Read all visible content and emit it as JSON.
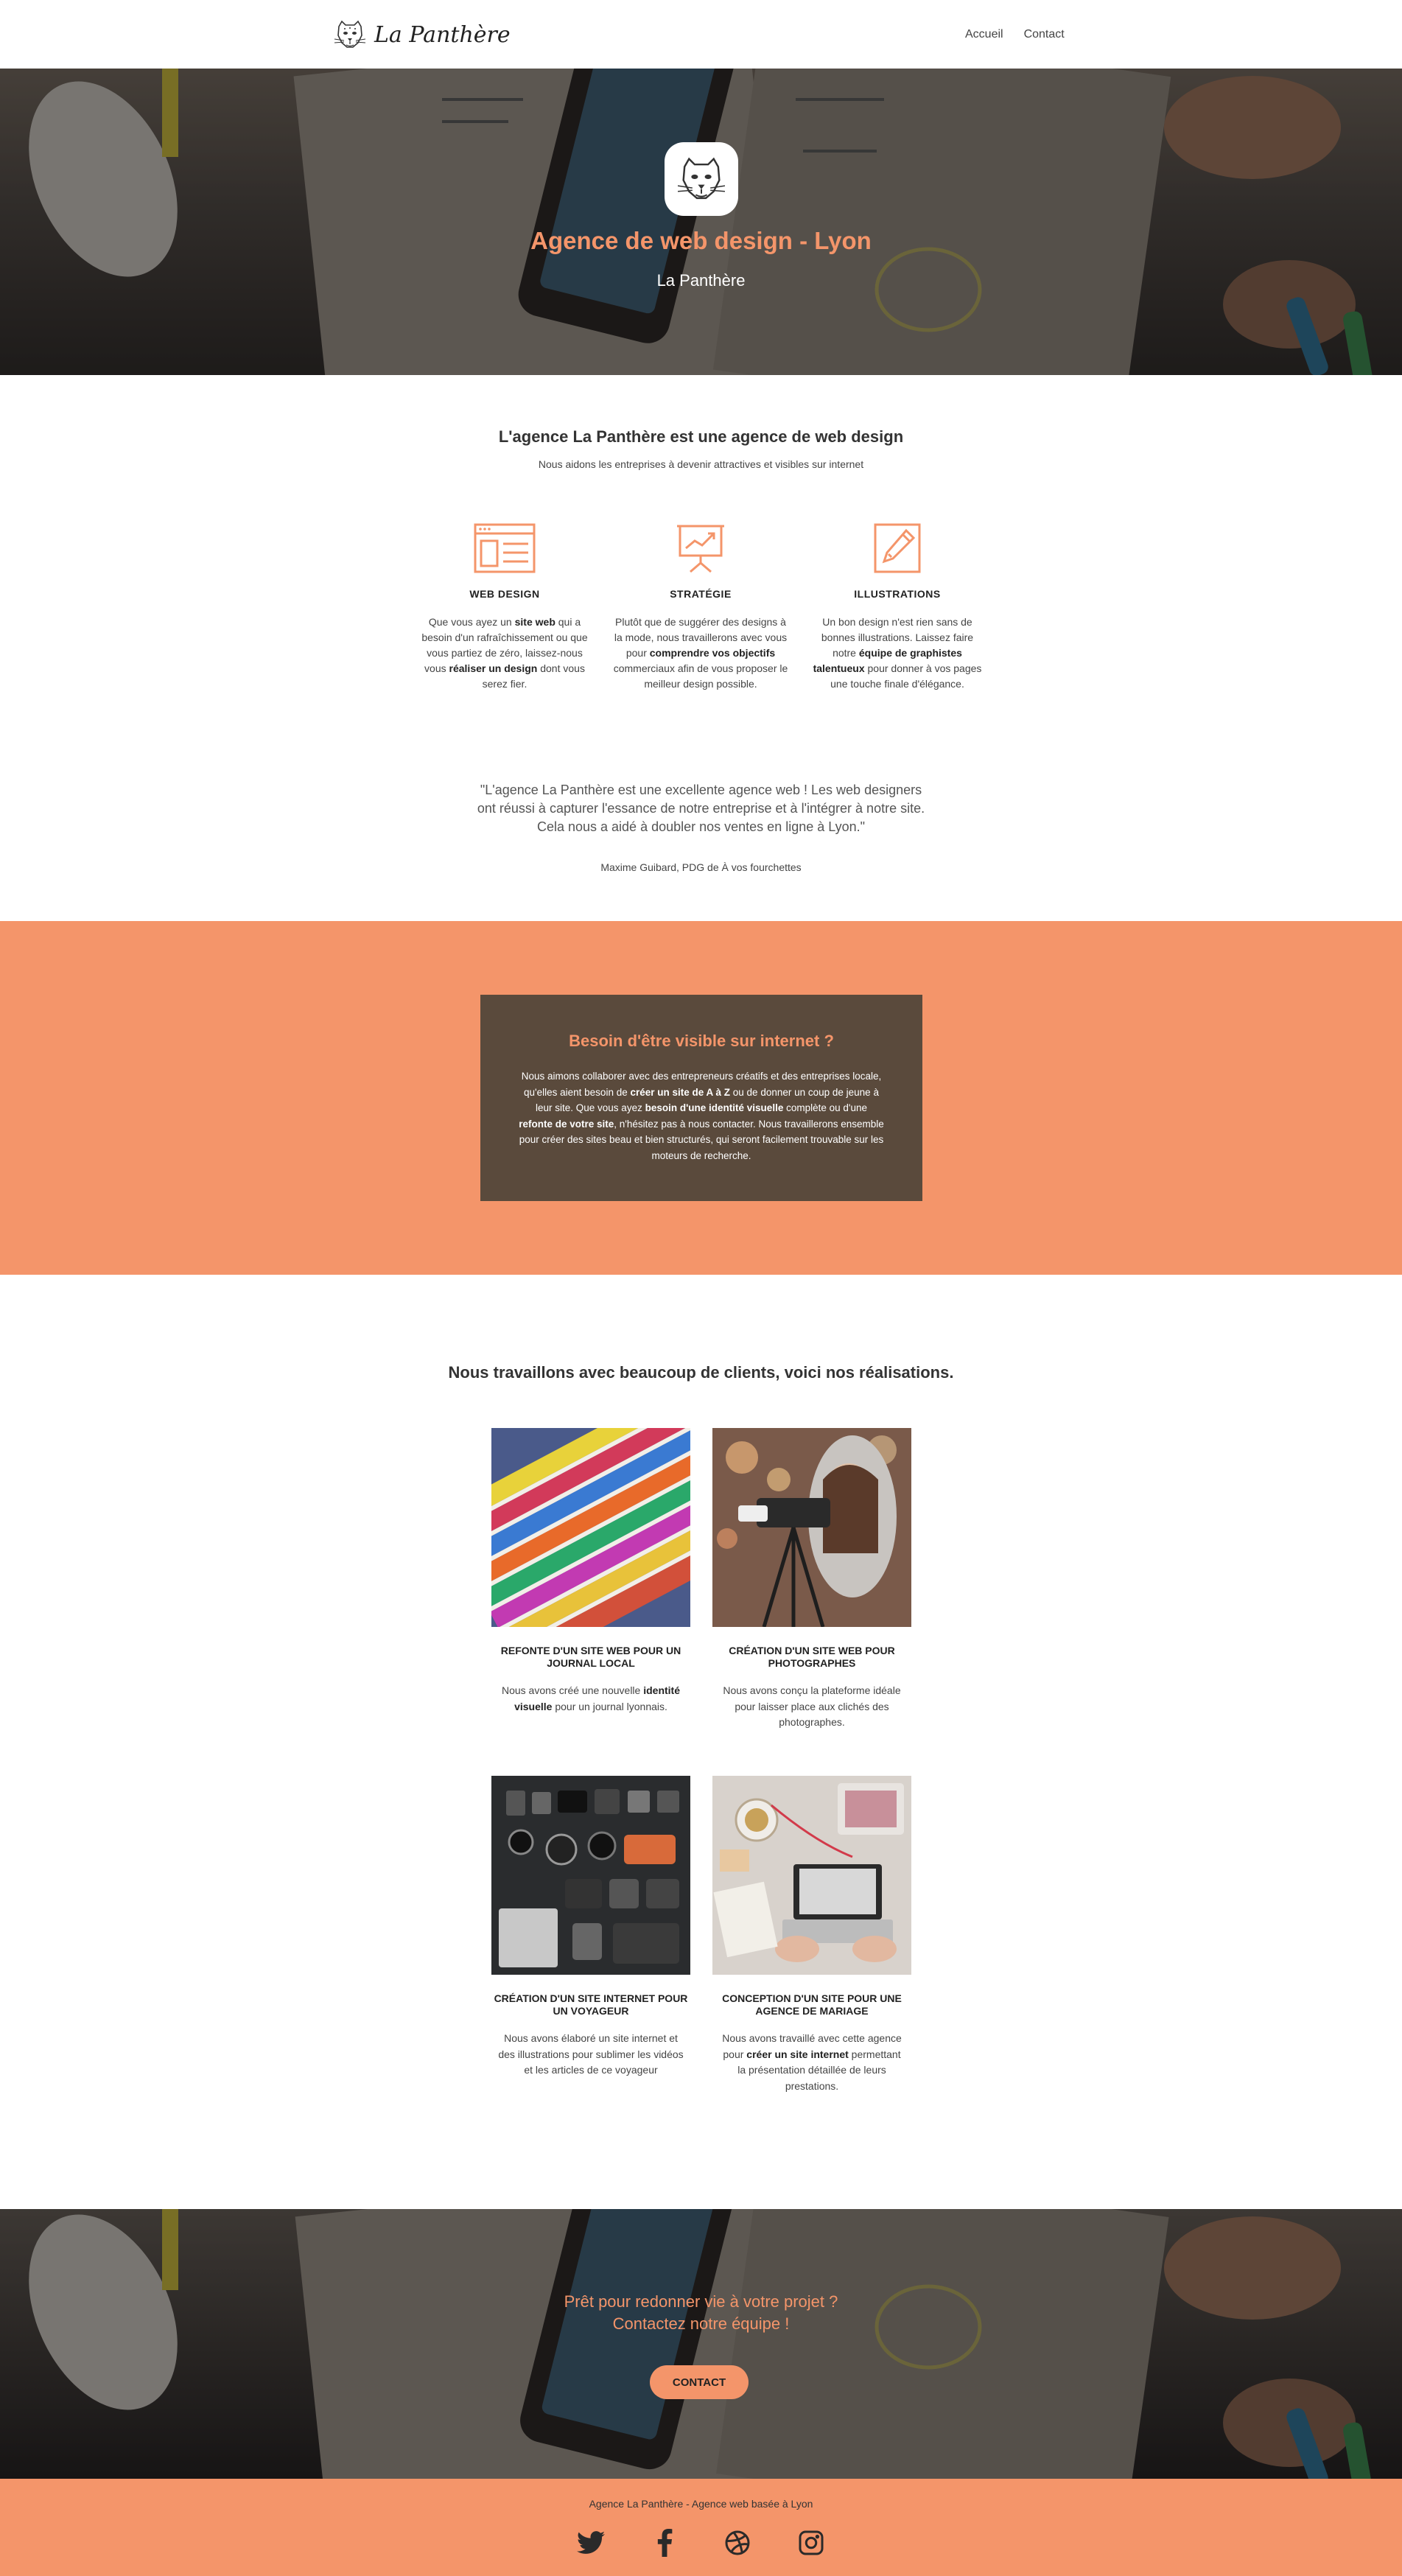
{
  "nav": {
    "brand_name": "La Panthère",
    "links": [
      "Accueil",
      "Contact"
    ]
  },
  "hero": {
    "title": "Agence de web design - Lyon",
    "subtitle": "La Panthère"
  },
  "intro": {
    "title": "L'agence La Panthère est une agence de web design",
    "subtitle": "Nous aidons les entreprises à devenir attractives et visibles sur internet"
  },
  "services": [
    {
      "icon": "web-layout-icon",
      "title": "WEB DESIGN",
      "parts": [
        {
          "t": "Que vous ayez un ",
          "b": false
        },
        {
          "t": "site web",
          "b": true
        },
        {
          "t": " qui a besoin d'un rafraîchissement ou que vous partiez de zéro, laissez-nous vous ",
          "b": false
        },
        {
          "t": "réaliser un design",
          "b": true
        },
        {
          "t": " dont vous serez fier.",
          "b": false
        }
      ]
    },
    {
      "icon": "presentation-chart-icon",
      "title": "STRATÉGIE",
      "parts": [
        {
          "t": "Plutôt que de suggérer des designs à la mode, nous travaillerons avec vous pour ",
          "b": false
        },
        {
          "t": "comprendre vos objectifs",
          "b": true
        },
        {
          "t": " commerciaux afin de vous proposer le meilleur design possible.",
          "b": false
        }
      ]
    },
    {
      "icon": "pencil-icon",
      "title": "ILLUSTRATIONS",
      "parts": [
        {
          "t": "Un bon design n'est rien sans de bonnes illustrations. Laissez faire notre ",
          "b": false
        },
        {
          "t": "équipe de graphistes talentueux",
          "b": true
        },
        {
          "t": " pour donner à vos pages une touche finale d'élégance.",
          "b": false
        }
      ]
    }
  ],
  "testimonial": {
    "quote": "\"L'agence La Panthère est une excellente agence web ! Les web designers ont réussi à capturer l'essance de notre entreprise et à l'intégrer à notre site. Cela nous a aidé à doubler nos ventes en ligne à Lyon.\"",
    "author": "Maxime Guibard, PDG de À vos fourchettes"
  },
  "visibility": {
    "title": "Besoin d'être visible sur internet ?",
    "parts": [
      {
        "t": "Nous aimons collaborer avec des entrepreneurs créatifs et des entreprises locale, qu'elles aient besoin de ",
        "b": false
      },
      {
        "t": "créer un site de A à Z",
        "b": true
      },
      {
        "t": " ou de donner un coup de jeune à leur site. Que vous ayez ",
        "b": false
      },
      {
        "t": "besoin d'une identité visuelle",
        "b": true
      },
      {
        "t": " complète ou d'une ",
        "b": false
      },
      {
        "t": "refonte de votre site",
        "b": true
      },
      {
        "t": ", n'hésitez pas à nous contacter. Nous travaillerons ensemble pour créer des sites beau et bien structurés, qui seront facilement trouvable sur les moteurs de recherche.",
        "b": false
      }
    ]
  },
  "work": {
    "title": "Nous travaillons avec beaucoup de clients, voici nos réalisations.",
    "projects": [
      {
        "image": "magazines-photo",
        "title": "Refonte d'un site web pour un journal local",
        "parts": [
          {
            "t": "Nous avons créé une nouvelle ",
            "b": false
          },
          {
            "t": "identité visuelle",
            "b": true
          },
          {
            "t": " pour un journal lyonnais.",
            "b": false
          }
        ]
      },
      {
        "image": "photographer-photo",
        "title": "Création d'un site web pour photographes",
        "parts": [
          {
            "t": "Nous avons conçu la plateforme idéale pour laisser place aux clichés des photographes.",
            "b": false
          }
        ]
      },
      {
        "image": "travel-gear-photo",
        "title": "Création d'un site internet pour un voyageur",
        "parts": [
          {
            "t": "Nous avons élaboré un site internet et des illustrations pour sublimer les vidéos et les articles de ce voyageur",
            "b": false
          }
        ]
      },
      {
        "image": "wedding-desk-photo",
        "title": "Conception d'un site pour une agence de mariage",
        "parts": [
          {
            "t": "Nous avons travaillé avec cette agence pour ",
            "b": false
          },
          {
            "t": "créer un site internet",
            "b": true
          },
          {
            "t": " permettant la présentation détaillée de leurs prestations.",
            "b": false
          }
        ]
      }
    ]
  },
  "cta": {
    "line1": "Prêt pour redonner vie à votre projet ?",
    "line2": "Contactez notre équipe !",
    "button": "CONTACT"
  },
  "footer": {
    "text": "Agence La Panthère - Agence web basée à Lyon",
    "socials": [
      "twitter-icon",
      "facebook-icon",
      "dribbble-icon",
      "instagram-icon"
    ]
  },
  "colors": {
    "accent": "#f4956a",
    "box": "#5a4a3c"
  }
}
